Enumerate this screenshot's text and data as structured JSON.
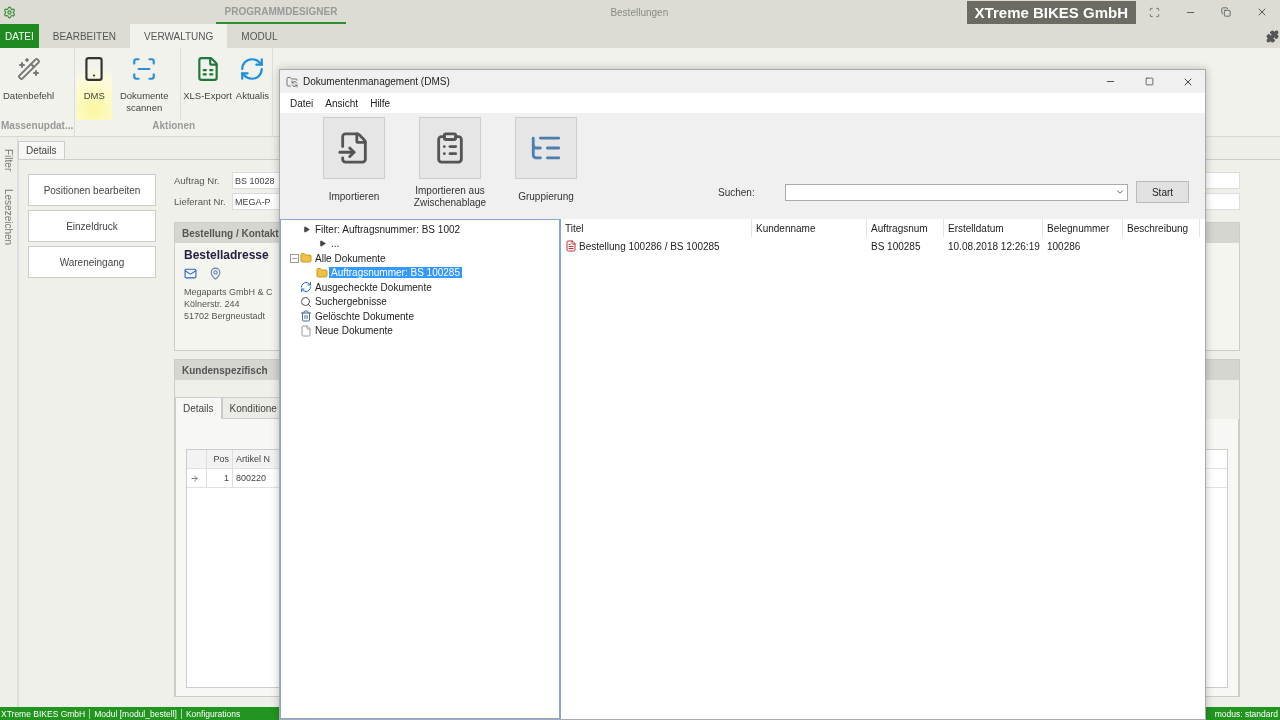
{
  "app_title_bar": {
    "section": "PROGRAMMDESIGNER",
    "title": "Bestellungen",
    "company": "XTreme BIKES GmbH"
  },
  "ribbon_tabs": [
    {
      "label": "DATEI",
      "kind": "file",
      "selected": false
    },
    {
      "label": "BEARBEITEN",
      "kind": "tab",
      "selected": false
    },
    {
      "label": "VERWALTUNG",
      "kind": "tab",
      "selected": true
    },
    {
      "label": "MODUL",
      "kind": "tab",
      "selected": false
    }
  ],
  "ribbon_groups": [
    {
      "label": "Massenupdat...",
      "commands": [
        {
          "label": "Datenbefehl",
          "kind": "wand",
          "hovered": false,
          "separator": false
        }
      ]
    },
    {
      "label": "Aktionen",
      "commands": [
        {
          "label": "DMS",
          "kind": "device",
          "hovered": true,
          "separator": false
        },
        {
          "label": "Dokumente scannen",
          "kind": "scanner",
          "hovered": false,
          "separator": false
        },
        {
          "label": "XLS-Export",
          "kind": "excel",
          "hovered": false,
          "separator": true
        },
        {
          "label": "Aktualis",
          "kind": "refresh",
          "hovered": false,
          "separator": false
        }
      ]
    }
  ],
  "side_tabs": [
    "Filter",
    "Lesezeichen"
  ],
  "document_tabs": [
    {
      "label": "Details",
      "selected": true
    }
  ],
  "actions": [
    "Positionen bearbeiten",
    "Einzeldruck",
    "Wareneingang"
  ],
  "fields": [
    {
      "label": "Auftrag Nr.",
      "value": "BS 10028"
    },
    {
      "label": "Lieferant Nr.",
      "value": "MEGA-P"
    }
  ],
  "contact_panel": {
    "title": "Bestellung / Kontakt",
    "heading": "Bestelladresse",
    "address": [
      "Megaparts GmbH & C",
      "Kölnerstr. 244",
      "51702 Bergneustadt"
    ]
  },
  "custom_panel": {
    "title": "Kundenspezifisch",
    "tabs": [
      {
        "label": "Details",
        "selected": true
      },
      {
        "label": "Konditione",
        "selected": false
      }
    ]
  },
  "grid": {
    "columns": [
      "Pos",
      "Artikel N"
    ],
    "rows": [
      {
        "current": true,
        "cells": [
          "1",
          "800220"
        ]
      }
    ]
  },
  "status_bar": [
    "XTreme BIKES GmbH",
    "Modul [modul_bestell]",
    "Konfigurations"
  ],
  "status_right": "modus: standard",
  "dialog": {
    "title": "Dokumentenmanagement (DMS)",
    "menu": [
      "Datei",
      "Ansicht",
      "Hilfe"
    ],
    "toolbar": [
      {
        "label": "Importieren",
        "kind": "import"
      },
      {
        "label": "Importieren aus Zwischenablage",
        "kind": "clipboard"
      },
      {
        "label": "Gruppierung",
        "kind": "grouping"
      }
    ],
    "search_label": "Suchen:",
    "start": "Start",
    "tree": [
      {
        "label": "Filter: Auftragsnummer: BS 1002",
        "kind": "filter",
        "selected": false,
        "children": [
          {
            "label": "...",
            "kind": "filter",
            "selected": false
          }
        ]
      },
      {
        "label": "Alle Dokumente",
        "kind": "folder",
        "selected": false,
        "expanded": true,
        "children": [
          {
            "label": "Auftragsnummer: BS 100285",
            "kind": "folder",
            "selected": true
          }
        ]
      },
      {
        "label": "Ausgecheckte Dokumente",
        "kind": "checkout",
        "selected": false
      },
      {
        "label": "Suchergebnisse",
        "kind": "search",
        "selected": false
      },
      {
        "label": "Gelöschte Dokumente",
        "kind": "trash",
        "selected": false
      },
      {
        "label": "Neue Dokumente",
        "kind": "blank",
        "selected": false
      }
    ],
    "list": {
      "columns": [
        "Titel",
        "Kundenname",
        "Auftragsnum",
        "Erstelldatum",
        "Belegnummer",
        "Beschreibung"
      ],
      "rows": [
        {
          "title": "Bestellung 100286 / BS 100285",
          "order_number": "BS 100285",
          "created": "10.08.2018 12:26:19",
          "document_number": "100286"
        }
      ]
    }
  }
}
